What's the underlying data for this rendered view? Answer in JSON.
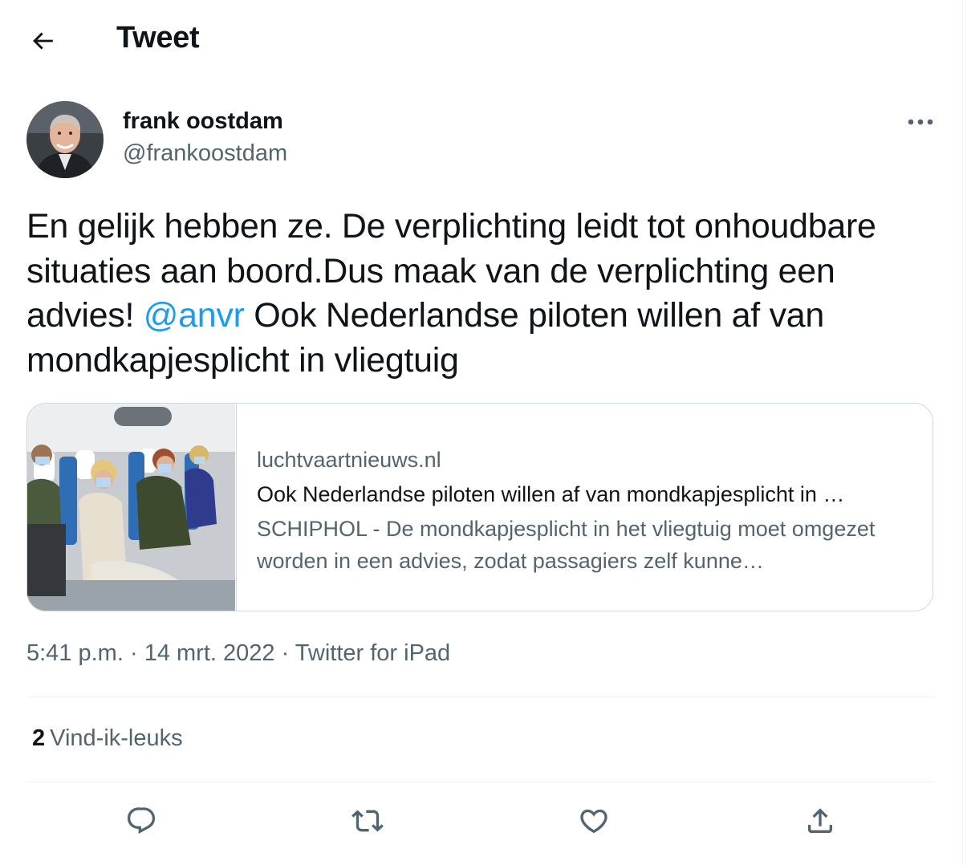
{
  "header": {
    "title": "Tweet",
    "back_icon": "arrow-left-icon"
  },
  "author": {
    "name": "frank oostdam",
    "handle": "@frankoostdam"
  },
  "tweet": {
    "text_before_mention": "En gelijk hebben ze. De verplichting leidt tot onhoudbare situaties aan boord.Dus maak van de verplichting een advies! ",
    "mention": "@anvr",
    "text_after_mention": " Ook Nederlandse piloten willen af van mondkapjesplicht in vliegtuig"
  },
  "card": {
    "domain": "luchtvaartnieuws.nl",
    "title": "Ook Nederlandse piloten willen af van mondkapjesplicht in …",
    "description": "SCHIPHOL - De mondkapjesplicht in het vliegtuig moet omgezet worden in een advies, zodat passagiers zelf kunne…"
  },
  "meta": {
    "time": "5:41 p.m.",
    "separator": " · ",
    "date": "14 mrt. 2022",
    "source": "Twitter for iPad"
  },
  "likes": {
    "count": "2",
    "label": "Vind-ik-leuks"
  },
  "actions": [
    "reply-icon",
    "retweet-icon",
    "like-icon",
    "share-icon"
  ],
  "colors": {
    "accent": "#1d9bf0",
    "secondary_text": "#536471",
    "border": "#cfd9de",
    "divider": "#eff3f4"
  }
}
